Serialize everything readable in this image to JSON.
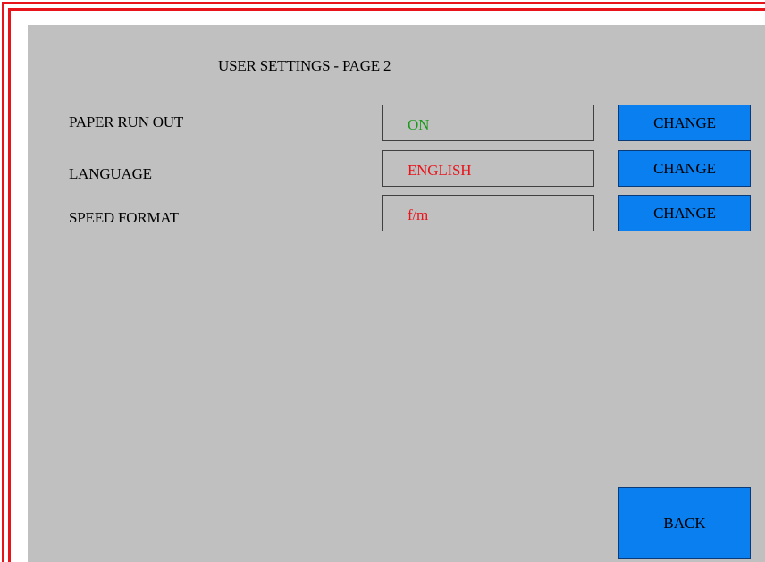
{
  "page": {
    "title": "USER SETTINGS - PAGE 2"
  },
  "settings": [
    {
      "label": "PAPER RUN OUT",
      "value": "ON",
      "value_color": "#1a9a1a",
      "button": "CHANGE"
    },
    {
      "label": "LANGUAGE",
      "value": "ENGLISH",
      "value_color": "#e8141b",
      "button": "CHANGE"
    },
    {
      "label": "SPEED FORMAT",
      "value": "f/m",
      "value_color": "#e8141b",
      "button": "CHANGE"
    }
  ],
  "footer": {
    "back_label": "BACK"
  },
  "colors": {
    "background": "#c0c0c0",
    "button": "#0a7ff0",
    "frame": "#e8141b"
  }
}
